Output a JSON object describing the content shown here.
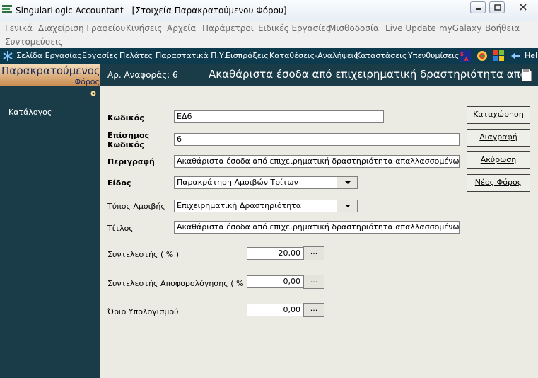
{
  "window": {
    "title": "SingularLogic Accountant - [Στοιχεία Παρακρατούμενου Φόρου]"
  },
  "menu": [
    "Γενικά",
    "Διαχείριση Γραφείου",
    "Κινήσεις",
    "Αρχεία",
    "Παράμετροι",
    "Ειδικές Εργασίες",
    "Μισθοδοσία",
    "Live Update",
    "myGalaxy",
    "Βοήθεια",
    "Συντομεύσεις"
  ],
  "toolbar": {
    "items": [
      "Σελίδα Εργασίας",
      "Εργασίες",
      "Πελάτες",
      "Παραστατικά Π.Υ.",
      "Εισπράξεις",
      "Καταθέσεις-Αναλήψεις",
      "Καταστάσεις",
      "Υπενθυμίσεις"
    ],
    "help_label": "Help"
  },
  "left_panel": {
    "title": "Παρακρατούμενος",
    "subtitle": "Φόρος",
    "links": [
      "Κατάλογος"
    ]
  },
  "header": {
    "ref_label": "Αρ. Αναφοράς:",
    "ref_value": "6",
    "title": "Ακαθάριστα έσοδα από επιχειρηματική δραστηριότητα απα."
  },
  "form": {
    "code_label": "Κωδικός",
    "code_value": "ΕΔ6",
    "official_code_label_1": "Επίσημος",
    "official_code_label_2": "Κωδικός",
    "official_code_value": "6",
    "description_label": "Περιγραφή",
    "description_value": "Ακαθάριστα έσοδα από επιχειρηματική δραστηριότητα απαλλασσομένων, μη υπ",
    "type_label": "Είδος",
    "type_value": "Παρακράτηση Αμοιβών Τρίτων",
    "fee_type_label": "Τύπος Αμοιβής",
    "fee_type_value": "Επιχειρηματική Δραστηριότητα",
    "caption_label": "Τίτλος",
    "caption_value": "Ακαθάριστα έσοδα από επιχειρηματική δραστηριότητα απαλλασσομένων",
    "rate_label": "Συντελεστής ( % )",
    "rate_value": "20,00",
    "discharge_rate_label": "Συντελεστής Αποφορολόγησης ( % )",
    "discharge_rate_value": "0,00",
    "limit_label": "Όριο Υπολογισμού",
    "limit_value": "0,00",
    "dots_label": "..."
  },
  "actions": {
    "save": "Καταχώρηση",
    "delete": "Διαγραφή",
    "cancel": "Ακύρωση",
    "new": "Νέος Φόρος"
  },
  "colors": {
    "panel_dark": "#1a3c48",
    "toolbar": "#0e3a4e",
    "form_bg": "#ecebe3",
    "header_gradient_top": "#f3dcbb",
    "header_gradient_bottom": "#c88a4d"
  },
  "icons": [
    "app-logo-icon",
    "minimize-icon",
    "maximize-icon",
    "close-icon",
    "snowflake-icon",
    "sa-logo-icon",
    "galaxy-icon",
    "windows-icon",
    "back-arrow-icon",
    "pin-icon",
    "document-icon"
  ]
}
